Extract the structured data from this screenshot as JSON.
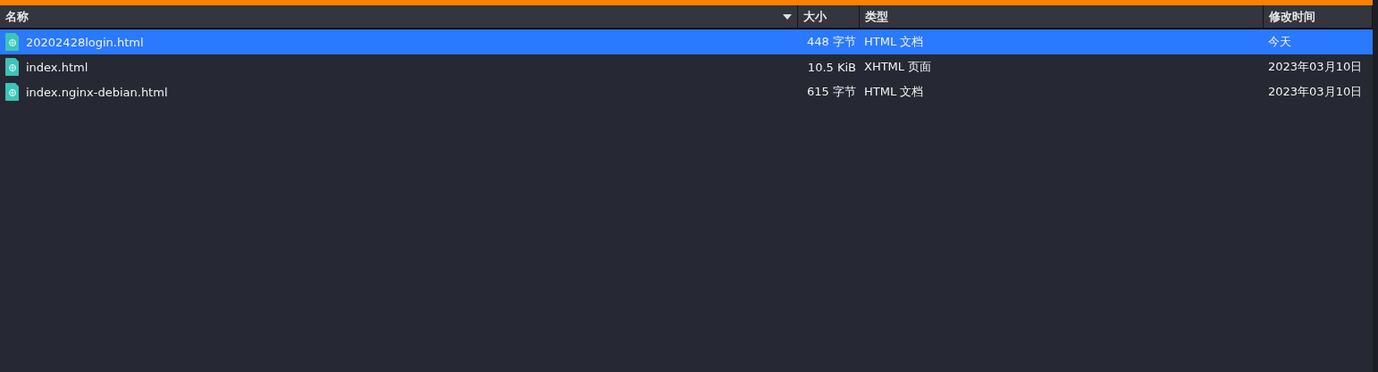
{
  "columns": [
    {
      "label": "名称",
      "sorted": true
    },
    {
      "label": "大小",
      "sorted": false
    },
    {
      "label": "类型",
      "sorted": false
    },
    {
      "label": "修改时间",
      "sorted": false
    }
  ],
  "rows": [
    {
      "name": "20202428login.html",
      "size": "448 字节",
      "type": "HTML 文档",
      "modified": "今天",
      "selected": true
    },
    {
      "name": "index.html",
      "size": "10.5 KiB",
      "type": "XHTML 页面",
      "modified": "2023年03月10日",
      "selected": false
    },
    {
      "name": "index.nginx-debian.html",
      "size": "615 字节",
      "type": "HTML 文档",
      "modified": "2023年03月10日",
      "selected": false
    }
  ]
}
